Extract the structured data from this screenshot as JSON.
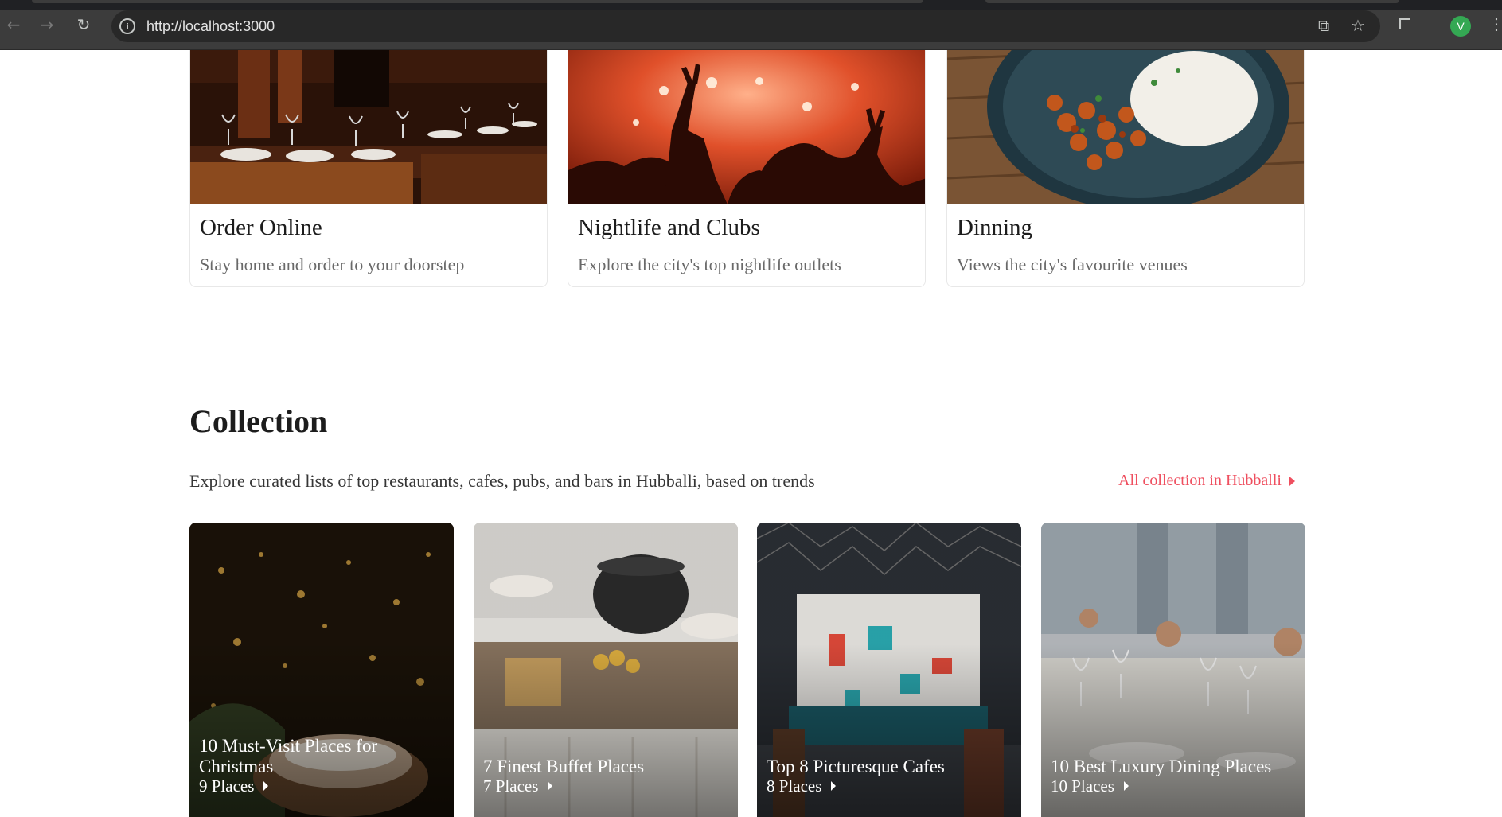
{
  "browser": {
    "url": "http://localhost:3000",
    "avatar_letter": "V",
    "icons": {
      "back": "arrow-left-icon",
      "forward": "arrow-right-icon",
      "reload": "reload-icon",
      "site_info": "info-icon",
      "install": "install-app-icon",
      "bookmark": "star-icon",
      "extensions": "puzzle-icon",
      "menu": "kebab-menu-icon"
    }
  },
  "cards": [
    {
      "title": "Order Online",
      "subtitle": "Stay home and order to your doorstep"
    },
    {
      "title": "Nightlife and Clubs",
      "subtitle": "Explore the city's top nightlife outlets"
    },
    {
      "title": "Dinning",
      "subtitle": "Views the city's favourite venues"
    }
  ],
  "collection": {
    "title": "Collection",
    "description": "Explore curated lists of top restaurants, cafes, pubs, and bars in Hubballi, based on trends",
    "all_link": "All collection in Hubballi",
    "items": [
      {
        "title": "10 Must-Visit Places for Christmas",
        "places": "9 Places"
      },
      {
        "title": "7 Finest Buffet Places",
        "places": "7 Places"
      },
      {
        "title": "Top 8 Picturesque Cafes",
        "places": "8 Places"
      },
      {
        "title": "10 Best Luxury Dining Places",
        "places": "10 Places"
      }
    ]
  },
  "colors": {
    "accent": "#ef4f5f",
    "chrome_bg": "#3c3c3c",
    "omnibox_bg": "#282828"
  }
}
